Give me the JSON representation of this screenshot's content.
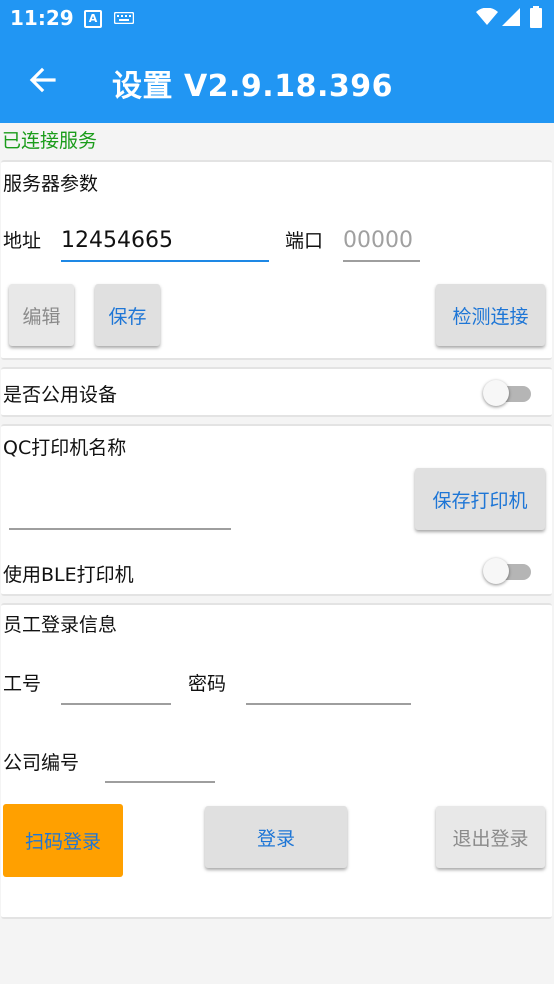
{
  "status_bar": {
    "time": "11:29"
  },
  "app_bar": {
    "title": "设置 V2.9.18.396"
  },
  "connection_status": "已连接服务",
  "colors": {
    "primary": "#2196f3",
    "connected_text": "#1a9c1a",
    "accent_button": "#ffa000",
    "button_text": "#1e76d6"
  },
  "server_params": {
    "section_title": "服务器参数",
    "address_label": "地址",
    "address_value": "12454665",
    "port_label": "端口",
    "port_placeholder": "00000",
    "edit_button": "编辑",
    "save_button": "保存",
    "test_connection_button": "检测连接"
  },
  "public_device": {
    "label": "是否公用设备",
    "enabled": false
  },
  "printer": {
    "section_title": "QC打印机名称",
    "name_value": "",
    "save_printer_button": "保存打印机",
    "ble_label": "使用BLE打印机",
    "ble_enabled": false
  },
  "employee_login": {
    "section_title": "员工登录信息",
    "employee_id_label": "工号",
    "employee_id_value": "",
    "password_label": "密码",
    "password_value": "",
    "company_id_label": "公司编号",
    "company_id_value": "",
    "scan_login_button": "扫码登录",
    "login_button": "登录",
    "logout_button": "退出登录"
  }
}
